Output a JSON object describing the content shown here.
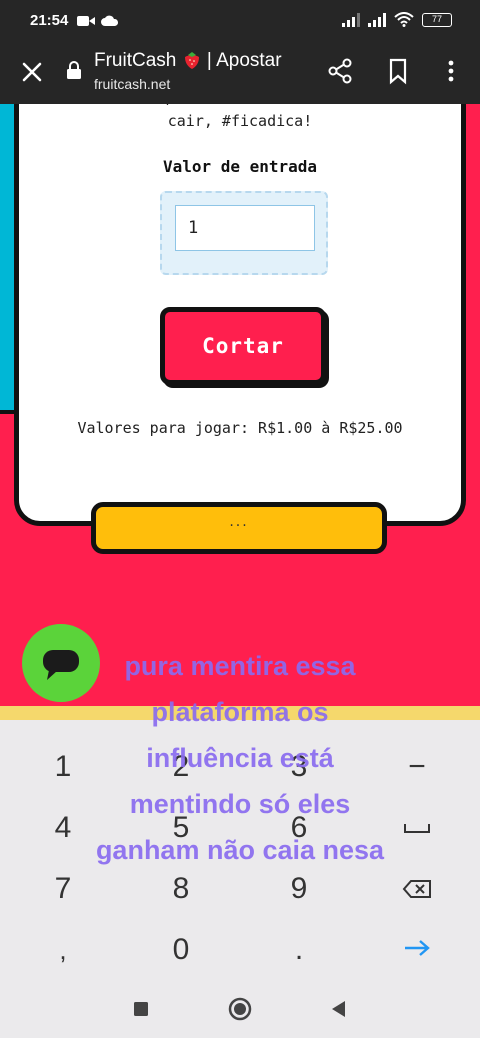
{
  "status_bar": {
    "time": "21:54",
    "battery": "77",
    "icons": [
      "video-camera-icon",
      "cloud-icon",
      "signal-icon",
      "signal-icon",
      "wifi-icon",
      "battery-icon"
    ]
  },
  "browser": {
    "title": "FruitCash 🍓 | Apostar",
    "title_text": "FruitCash",
    "title_suffix": "| Apostar",
    "url": "fruitcash.net",
    "icons": [
      "close-icon",
      "lock-icon",
      "strawberry-icon",
      "share-icon",
      "bookmark-icon",
      "more-vertical-icon"
    ]
  },
  "card": {
    "intro_partial": "seu valor, e é melhor não deixar ela",
    "intro_line2": "cair, #ficadica!",
    "entry_label": "Valor de entrada",
    "entry_value": "1",
    "cut_button": "Cortar",
    "range_text": "Valores para jogar: R$1.00 à R$25.00",
    "more_dots": "..."
  },
  "overlay_comment": [
    "pura mentira essa",
    "plataforma os",
    "influência está",
    "mentindo só eles",
    "ganham não caia nesa"
  ],
  "keyboard": {
    "rows": [
      [
        "1",
        "2",
        "3",
        "−"
      ],
      [
        "4",
        "5",
        "6",
        "space"
      ],
      [
        "7",
        "8",
        "9",
        "backspace"
      ],
      [
        ",",
        "0",
        ".",
        "enter"
      ]
    ],
    "icons": [
      "space-icon",
      "backspace-icon",
      "enter-arrow-icon"
    ]
  },
  "nav_bar": {
    "icons": [
      "recent-apps-icon",
      "home-icon",
      "back-icon"
    ]
  },
  "colors": {
    "page_background": "#ff1f4e",
    "side_panel": "#00b7d6",
    "more_bar": "#ffbe0b",
    "chat_fab": "#5bd33a",
    "overlay_text": "#8a6cf0",
    "keyboard": "#ebeaec"
  }
}
